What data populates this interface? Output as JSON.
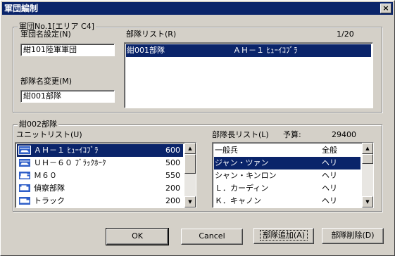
{
  "window": {
    "title": "軍団編制",
    "close_glyph": "×"
  },
  "corps_group": {
    "title": "軍団No.1[エリア C4]",
    "corps_name_label": "軍団名設定(N)",
    "corps_name_value": "紺101陸軍軍団",
    "unit_rename_label": "部隊名変更(M)",
    "unit_rename_value": "紺001部隊",
    "unit_list_label": "部隊リスト(R)",
    "unit_count": "1/20",
    "unit_list": [
      {
        "name": "紺001部隊",
        "type": "ＡＨ－１ ﾋｭｰｲｺﾌﾞﾗ",
        "selected": true
      }
    ]
  },
  "unit_group": {
    "title": "紺002部隊",
    "unit_type_list_label": "ユニットリスト(U)",
    "unit_types": [
      {
        "icon": "helicopter-icon",
        "name": "ＡＨ－１ ﾋｭｰｲｺﾌﾞﾗ",
        "cost": "600",
        "selected": true
      },
      {
        "icon": "helicopter-icon",
        "name": "ＵＨ－６０ ﾌﾞﾗｯｸﾎｰｸ",
        "cost": "500",
        "selected": false
      },
      {
        "icon": "tank-icon",
        "name": "Ｍ６０",
        "cost": "550",
        "selected": false
      },
      {
        "icon": "recon-vehicle-icon",
        "name": "偵察部隊",
        "cost": "200",
        "selected": false
      },
      {
        "icon": "truck-icon",
        "name": "トラック",
        "cost": "200",
        "selected": false
      }
    ],
    "leader_list_label": "部隊長リスト(L)",
    "budget_label": "予算:",
    "budget_value": "29400",
    "leaders": [
      {
        "name": "一般兵",
        "type": "全般",
        "selected": false
      },
      {
        "name": "ジャン・ツァン",
        "type": "ヘリ",
        "selected": true
      },
      {
        "name": "シャン・キンロン",
        "type": "ヘリ",
        "selected": false
      },
      {
        "name": "Ｌ．カーディン",
        "type": "ヘリ",
        "selected": false
      },
      {
        "name": "Ｋ．キャノン",
        "type": "ヘリ",
        "selected": false
      }
    ]
  },
  "buttons": {
    "ok": "OK",
    "cancel": "Cancel",
    "add_unit": "部隊追加(A)",
    "delete_unit": "部隊削除(D)"
  }
}
